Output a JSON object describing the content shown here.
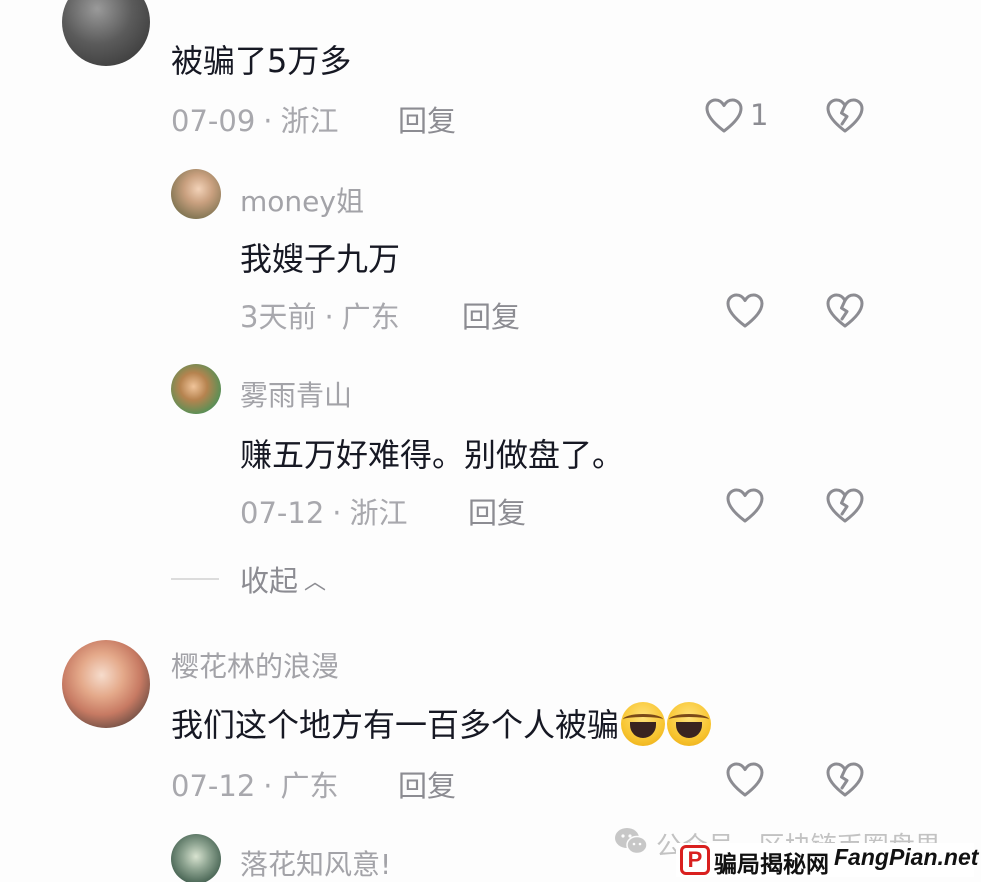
{
  "comments": [
    {
      "id": "top",
      "content": "被骗了5万多",
      "date": "07-09",
      "location": "浙江",
      "reply_label": "回复",
      "like_count": "1"
    },
    {
      "id": "money",
      "username": "money姐",
      "content": "我嫂子九万",
      "date": "3天前",
      "location": "广东",
      "reply_label": "回复"
    },
    {
      "id": "fog",
      "username": "雾雨青山",
      "content": "赚五万好难得。别做盘了。",
      "date": "07-12",
      "location": "浙江",
      "reply_label": "回复"
    },
    {
      "id": "sakura",
      "username": "樱花林的浪漫",
      "content": "我们这个地方有一百多个人被骗",
      "date": "07-12",
      "location": "广东",
      "reply_label": "回复"
    },
    {
      "id": "luohua",
      "username": "落花知风意!"
    }
  ],
  "separator": "·",
  "collapse_label": "收起",
  "watermark": {
    "account": "公众号 · 区块链币圈盘界",
    "logo_letter": "P",
    "text": "骗局揭秘网",
    "site": "FangPian.net"
  },
  "icons": {
    "like": "heart-outline-icon",
    "dislike": "broken-heart-icon",
    "collapse": "chevron-up-icon",
    "emoji": "laughing-crying-emoji-icon",
    "watermark": "wechat-icon"
  },
  "colors": {
    "text_primary": "#161823",
    "text_secondary": "#a8a8ad",
    "icon_gray": "#8c8c92",
    "watermark_red": "#d9201f"
  }
}
